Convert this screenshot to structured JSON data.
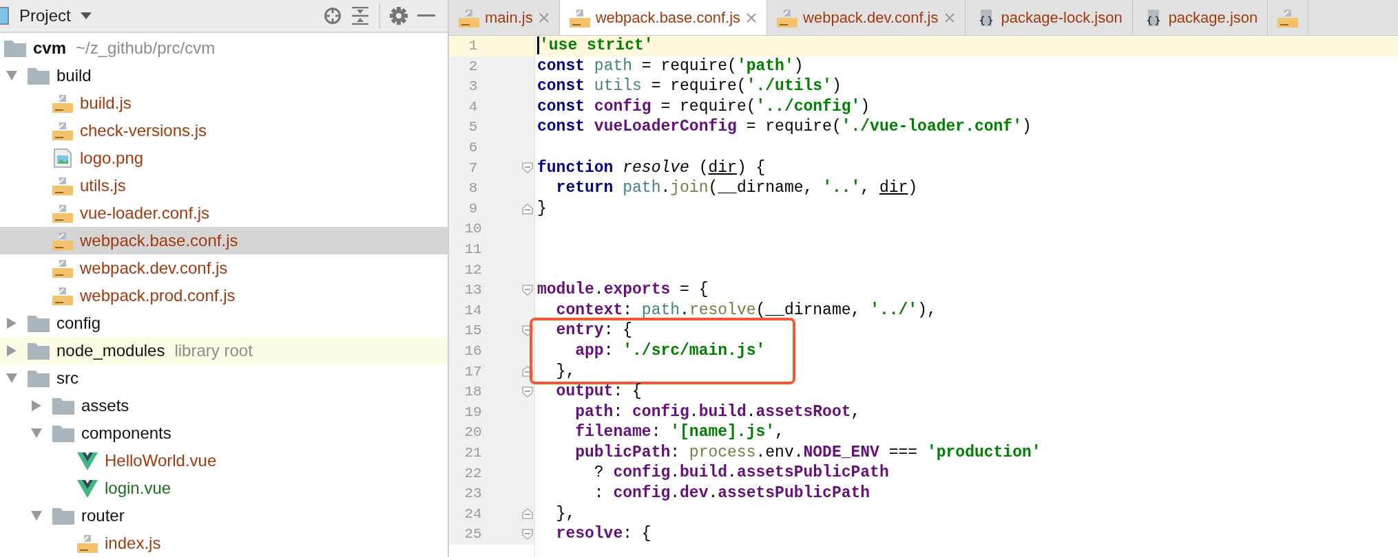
{
  "project_panel": {
    "title": "Project",
    "tree": [
      {
        "kind": "root",
        "label": "cvm",
        "hint": "~/z_github/prc/cvm",
        "children": [
          {
            "kind": "folder",
            "label": "build",
            "expanded": true,
            "children": [
              {
                "kind": "js",
                "label": "build.js",
                "color": "#a13a0e",
                "selected": false
              },
              {
                "kind": "js",
                "label": "check-versions.js",
                "color": "#a13a0e",
                "selected": false
              },
              {
                "kind": "image",
                "label": "logo.png",
                "color": "#a13a0e",
                "selected": false
              },
              {
                "kind": "js",
                "label": "utils.js",
                "color": "#a13a0e",
                "selected": false
              },
              {
                "kind": "js",
                "label": "vue-loader.conf.js",
                "color": "#a13a0e",
                "selected": false
              },
              {
                "kind": "js",
                "label": "webpack.base.conf.js",
                "color": "#a13a0e",
                "selected": true
              },
              {
                "kind": "js",
                "label": "webpack.dev.conf.js",
                "color": "#a13a0e",
                "selected": false
              },
              {
                "kind": "js",
                "label": "webpack.prod.conf.js",
                "color": "#a13a0e",
                "selected": false
              }
            ]
          },
          {
            "kind": "folder",
            "label": "config",
            "expanded": false
          },
          {
            "kind": "library",
            "label": "node_modules",
            "hint": "library root",
            "expanded": false
          },
          {
            "kind": "folder",
            "label": "src",
            "expanded": true,
            "children": [
              {
                "kind": "folder",
                "label": "assets",
                "expanded": false
              },
              {
                "kind": "folder",
                "label": "components",
                "expanded": true,
                "children": [
                  {
                    "kind": "vue",
                    "label": "HelloWorld.vue",
                    "color": "#a13a0e",
                    "selected": false
                  },
                  {
                    "kind": "vue",
                    "label": "login.vue",
                    "color": "#177017",
                    "selected": false
                  }
                ]
              },
              {
                "kind": "folder",
                "label": "router",
                "expanded": true,
                "children": [
                  {
                    "kind": "js",
                    "label": "index.js",
                    "color": "#a13a0e",
                    "selected": false
                  }
                ]
              }
            ]
          }
        ]
      }
    ]
  },
  "editor": {
    "tabs": [
      {
        "kind": "js",
        "label": "main.js",
        "selected": false,
        "closable": true
      },
      {
        "kind": "js",
        "label": "webpack.base.conf.js",
        "selected": true,
        "closable": true
      },
      {
        "kind": "js",
        "label": "webpack.dev.conf.js",
        "selected": false,
        "closable": true
      },
      {
        "kind": "json",
        "label": "package-lock.json",
        "selected": false,
        "closable": false
      },
      {
        "kind": "json",
        "label": "package.json",
        "selected": false,
        "closable": false
      },
      {
        "kind": "js",
        "selected": false,
        "closable": false
      }
    ],
    "lines": [
      {
        "number": "1",
        "current": true,
        "fold_start": false,
        "fold_end": false,
        "tokens": [
          {
            "kind": "str",
            "text": "'use strict'"
          }
        ]
      },
      {
        "number": "2",
        "current": false,
        "fold_start": false,
        "fold_end": false,
        "tokens": [
          {
            "kind": "kw",
            "text": "const "
          },
          {
            "kind": "loc",
            "text": "path"
          },
          {
            "kind": "pl",
            "text": " = require("
          },
          {
            "kind": "str",
            "text": "'path'"
          },
          {
            "kind": "pl",
            "text": ")"
          }
        ]
      },
      {
        "number": "3",
        "current": false,
        "fold_start": false,
        "fold_end": false,
        "tokens": [
          {
            "kind": "kw",
            "text": "const "
          },
          {
            "kind": "loc",
            "text": "utils"
          },
          {
            "kind": "pl",
            "text": " = require("
          },
          {
            "kind": "str",
            "text": "'./utils'"
          },
          {
            "kind": "pl",
            "text": ")"
          }
        ]
      },
      {
        "number": "4",
        "current": false,
        "fold_start": false,
        "fold_end": false,
        "tokens": [
          {
            "kind": "kw",
            "text": "const "
          },
          {
            "kind": "pur",
            "text": "config"
          },
          {
            "kind": "pl",
            "text": " = require("
          },
          {
            "kind": "str",
            "text": "'../config'"
          },
          {
            "kind": "pl",
            "text": ")"
          }
        ]
      },
      {
        "number": "5",
        "current": false,
        "fold_start": false,
        "fold_end": false,
        "tokens": [
          {
            "kind": "kw",
            "text": "const "
          },
          {
            "kind": "pur",
            "text": "vueLoaderConfig"
          },
          {
            "kind": "pl",
            "text": " = require("
          },
          {
            "kind": "str",
            "text": "'./vue-loader.conf'"
          },
          {
            "kind": "pl",
            "text": ")"
          }
        ]
      },
      {
        "number": "6",
        "current": false,
        "fold_start": false,
        "fold_end": false
      },
      {
        "number": "7",
        "current": false,
        "fold_start": true,
        "fold_end": false,
        "tokens": [
          {
            "kind": "kw",
            "text": "function "
          },
          {
            "kind": "fnd",
            "text": "resolve"
          },
          {
            "kind": "pl",
            "text": " ("
          },
          {
            "kind": "par",
            "text": "dir"
          },
          {
            "kind": "pl",
            "text": ") {"
          }
        ]
      },
      {
        "number": "8",
        "current": false,
        "fold_start": false,
        "fold_end": false,
        "tokens": [
          {
            "kind": "kw",
            "text": "  return "
          },
          {
            "kind": "loc",
            "text": "path"
          },
          {
            "kind": "pl",
            "text": "."
          },
          {
            "kind": "mth",
            "text": "join"
          },
          {
            "kind": "pl",
            "text": "(__dirname, "
          },
          {
            "kind": "str",
            "text": "'..'"
          },
          {
            "kind": "pl",
            "text": ", "
          },
          {
            "kind": "par",
            "text": "dir"
          },
          {
            "kind": "pl",
            "text": ")"
          }
        ]
      },
      {
        "number": "9",
        "current": false,
        "fold_start": false,
        "fold_end": true,
        "tokens": [
          {
            "kind": "pl",
            "text": "}"
          }
        ]
      },
      {
        "number": "10",
        "current": false,
        "fold_start": false,
        "fold_end": false
      },
      {
        "number": "11",
        "current": false,
        "fold_start": false,
        "fold_end": false
      },
      {
        "number": "12",
        "current": false,
        "fold_start": false,
        "fold_end": false
      },
      {
        "number": "13",
        "current": false,
        "fold_start": true,
        "fold_end": false,
        "tokens": [
          {
            "kind": "pur",
            "text": "module"
          },
          {
            "kind": "pl",
            "text": "."
          },
          {
            "kind": "pur",
            "text": "exports"
          },
          {
            "kind": "pl",
            "text": " = {"
          }
        ]
      },
      {
        "number": "14",
        "current": false,
        "fold_start": false,
        "fold_end": false,
        "tokens": [
          {
            "kind": "pur",
            "text": "  context"
          },
          {
            "kind": "pl",
            "text": ": "
          },
          {
            "kind": "loc",
            "text": "path"
          },
          {
            "kind": "pl",
            "text": "."
          },
          {
            "kind": "mth",
            "text": "resolve"
          },
          {
            "kind": "pl",
            "text": "(__dirname, "
          },
          {
            "kind": "str",
            "text": "'../'"
          },
          {
            "kind": "pl",
            "text": "),"
          }
        ]
      },
      {
        "number": "15",
        "current": false,
        "fold_start": true,
        "fold_end": false,
        "boxed": true,
        "tokens": [
          {
            "kind": "pur",
            "text": "  entry"
          },
          {
            "kind": "pl",
            "text": ": {"
          }
        ]
      },
      {
        "number": "16",
        "current": false,
        "fold_start": false,
        "fold_end": false,
        "boxed": true,
        "tokens": [
          {
            "kind": "pur",
            "text": "    app"
          },
          {
            "kind": "pl",
            "text": ": "
          },
          {
            "kind": "str",
            "text": "'./src/main.js'"
          }
        ]
      },
      {
        "number": "17",
        "current": false,
        "fold_start": false,
        "fold_end": true,
        "boxed": true,
        "tokens": [
          {
            "kind": "pl",
            "text": "  },"
          }
        ]
      },
      {
        "number": "18",
        "current": false,
        "fold_start": true,
        "fold_end": false,
        "tokens": [
          {
            "kind": "pur",
            "text": "  output"
          },
          {
            "kind": "pl",
            "text": ": {"
          }
        ]
      },
      {
        "number": "19",
        "current": false,
        "fold_start": false,
        "fold_end": false,
        "tokens": [
          {
            "kind": "pur",
            "text": "    path"
          },
          {
            "kind": "pl",
            "text": ": "
          },
          {
            "kind": "pur",
            "text": "config"
          },
          {
            "kind": "pl",
            "text": "."
          },
          {
            "kind": "pur",
            "text": "build"
          },
          {
            "kind": "pl",
            "text": "."
          },
          {
            "kind": "pur",
            "text": "assetsRoot"
          },
          {
            "kind": "pl",
            "text": ","
          }
        ]
      },
      {
        "number": "20",
        "current": false,
        "fold_start": false,
        "fold_end": false,
        "tokens": [
          {
            "kind": "pur",
            "text": "    filename"
          },
          {
            "kind": "pl",
            "text": ": "
          },
          {
            "kind": "str",
            "text": "'[name].js'"
          },
          {
            "kind": "pl",
            "text": ","
          }
        ]
      },
      {
        "number": "21",
        "current": false,
        "fold_start": false,
        "fold_end": false,
        "tokens": [
          {
            "kind": "pur",
            "text": "    publicPath"
          },
          {
            "kind": "pl",
            "text": ": "
          },
          {
            "kind": "mth",
            "text": "process"
          },
          {
            "kind": "pl",
            "text": ".env."
          },
          {
            "kind": "pur",
            "text": "NODE_ENV"
          },
          {
            "kind": "pl",
            "text": " === "
          },
          {
            "kind": "str",
            "text": "'production'"
          }
        ]
      },
      {
        "number": "22",
        "current": false,
        "fold_start": false,
        "fold_end": false,
        "tokens": [
          {
            "kind": "pl",
            "text": "      ? "
          },
          {
            "kind": "pur",
            "text": "config"
          },
          {
            "kind": "pl",
            "text": "."
          },
          {
            "kind": "pur",
            "text": "build"
          },
          {
            "kind": "pl",
            "text": "."
          },
          {
            "kind": "pur",
            "text": "assetsPublicPath"
          }
        ]
      },
      {
        "number": "23",
        "current": false,
        "fold_start": false,
        "fold_end": false,
        "tokens": [
          {
            "kind": "pl",
            "text": "      : "
          },
          {
            "kind": "pur",
            "text": "config"
          },
          {
            "kind": "pl",
            "text": "."
          },
          {
            "kind": "pur",
            "text": "dev"
          },
          {
            "kind": "pl",
            "text": "."
          },
          {
            "kind": "pur",
            "text": "assetsPublicPath"
          }
        ]
      },
      {
        "number": "24",
        "current": false,
        "fold_start": false,
        "fold_end": true,
        "tokens": [
          {
            "kind": "pl",
            "text": "  },"
          }
        ]
      },
      {
        "number": "25",
        "current": false,
        "fold_start": true,
        "fold_end": false,
        "tokens": [
          {
            "kind": "pur",
            "text": "  resolve"
          },
          {
            "kind": "pl",
            "text": ": {"
          }
        ]
      }
    ]
  }
}
